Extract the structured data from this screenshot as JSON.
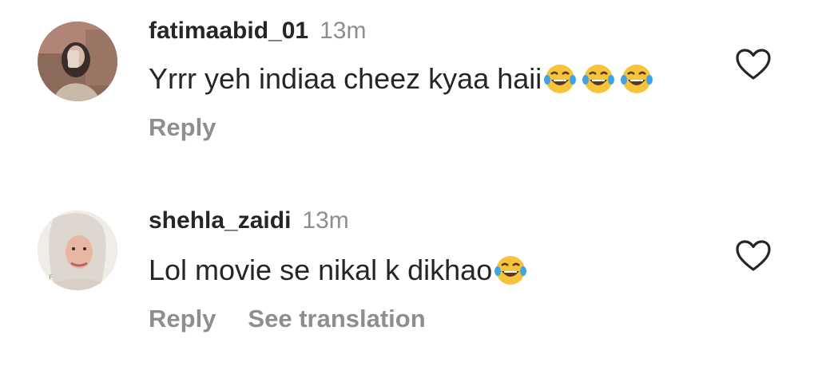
{
  "comments": [
    {
      "username": "fatimaabid_01",
      "time": "13m",
      "text": "Yrrr yeh indiaa cheez kyaa haii",
      "emojis": [
        "face-with-tears-of-joy",
        "face-with-tears-of-joy",
        "face-with-tears-of-joy"
      ],
      "reply_label": "Reply"
    },
    {
      "username": "shehla_zaidi",
      "time": "13m",
      "text": "Lol movie se nikal k dikhao",
      "emojis": [
        "face-with-tears-of-joy"
      ],
      "reply_label": "Reply",
      "translate_label": "See translation"
    }
  ],
  "icons": {
    "like": "heart-outline-icon",
    "emoji": "face-with-tears-of-joy"
  },
  "colors": {
    "primary_text": "#262626",
    "secondary_text": "#8e8e8e",
    "emoji_yellow": "#f7c33b",
    "tear_blue": "#3fa4e6"
  }
}
